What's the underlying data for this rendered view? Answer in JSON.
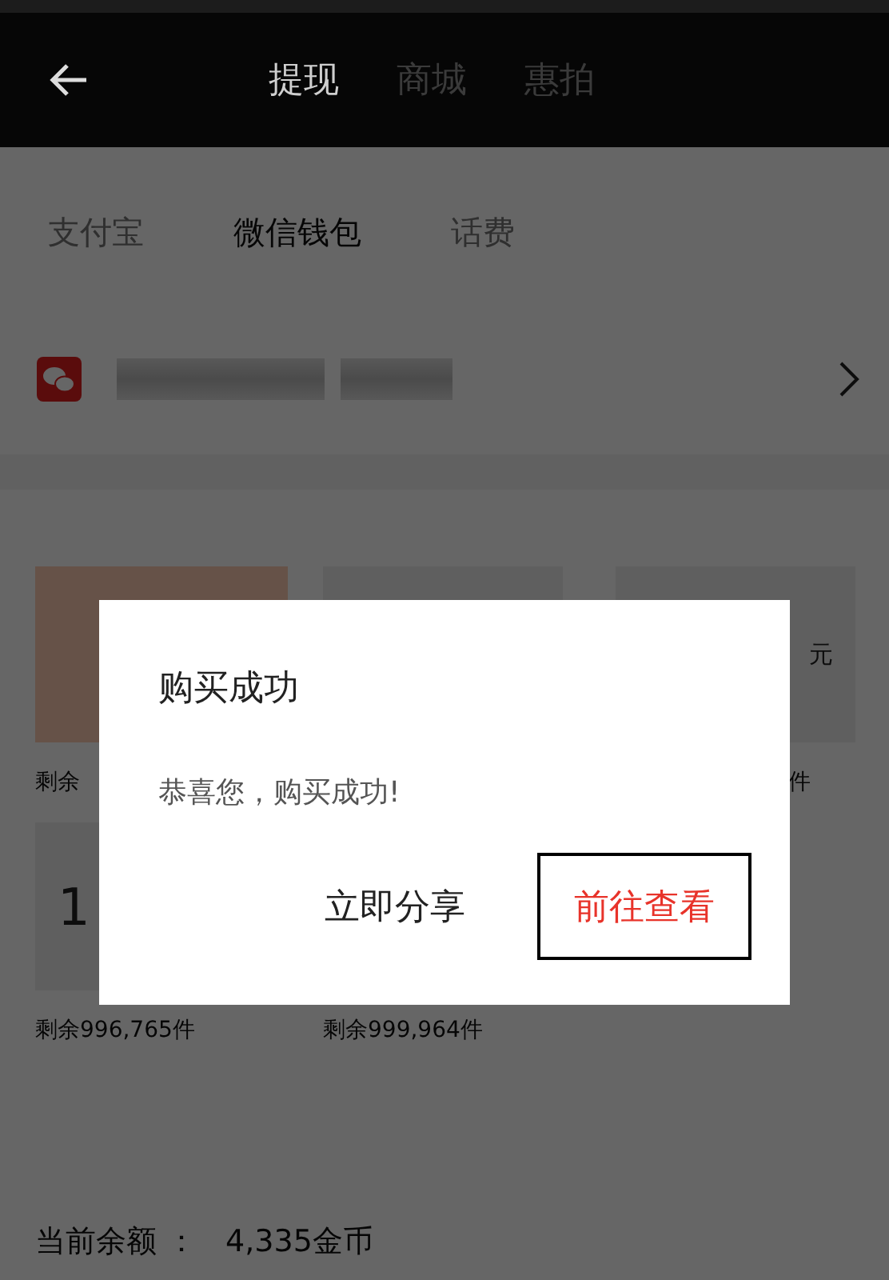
{
  "header": {
    "tabs": [
      {
        "label": "提现",
        "selected": true
      },
      {
        "label": "商城",
        "selected": false
      },
      {
        "label": "惠拍",
        "selected": false
      }
    ]
  },
  "pay_tabs": [
    {
      "label": "支付宝",
      "selected": false
    },
    {
      "label": "微信钱包",
      "selected": true
    },
    {
      "label": "话费",
      "selected": false
    }
  ],
  "account": {
    "name_redacted": true
  },
  "products": [
    {
      "highlighted": true,
      "remaining": "剩余"
    },
    {
      "highlighted": false
    },
    {
      "highlighted": false,
      "value": "元",
      "remaining": "件"
    },
    {
      "highlighted": false,
      "value": "1",
      "remaining": "剩余996,765件"
    },
    {
      "remaining": "剩余999,964件"
    }
  ],
  "balance": {
    "label": "当前余额 ：",
    "value": "4,335金币"
  },
  "dialog": {
    "title": "购买成功",
    "message": "恭喜您，购买成功!",
    "buttons": [
      {
        "label": "立即分享",
        "kind": "default",
        "focused": false
      },
      {
        "label": "前往查看",
        "kind": "primary",
        "focused": true
      }
    ]
  }
}
